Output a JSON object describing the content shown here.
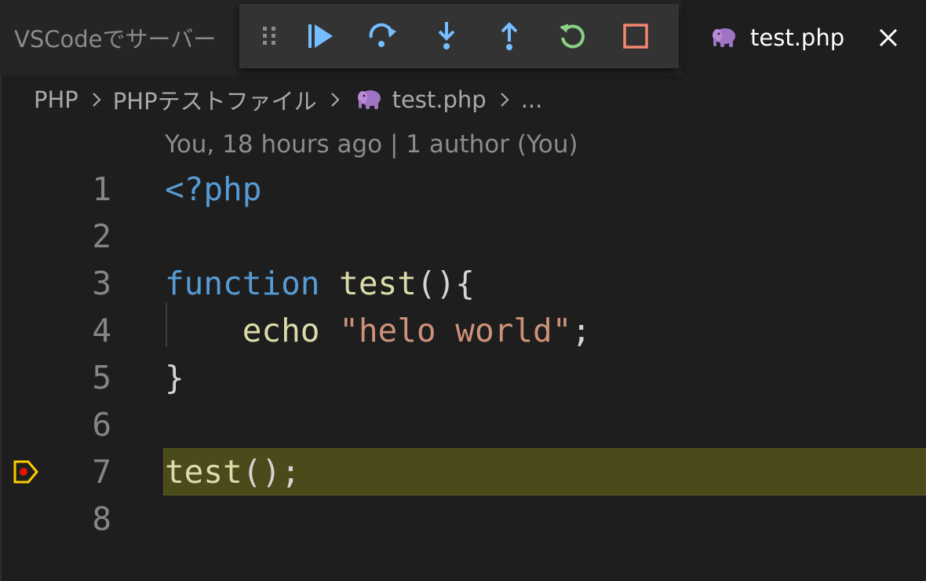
{
  "tabs": {
    "inactive_label": "VSCodeでサーバー",
    "active_label": "test.php"
  },
  "debug_toolbar": {
    "buttons": [
      "drag-handle",
      "continue",
      "step-over",
      "step-into",
      "step-out",
      "restart",
      "stop"
    ],
    "colors": {
      "blue": "#75beff",
      "green": "#89d185",
      "red": "#f48771"
    }
  },
  "breadcrumb": {
    "items": [
      "PHP",
      "PHPテストファイル",
      "test.php",
      "..."
    ]
  },
  "blame": {
    "text": "You, 18 hours ago | 1 author (You)"
  },
  "editor": {
    "current_line": 7,
    "lines": [
      {
        "number": "1",
        "tokens": [
          "<?php"
        ]
      },
      {
        "number": "2",
        "tokens": []
      },
      {
        "number": "3",
        "tokens": [
          "function",
          "test",
          "(){"
        ]
      },
      {
        "number": "4",
        "tokens": [
          "echo",
          "\"helo world\"",
          ";"
        ]
      },
      {
        "number": "5",
        "tokens": [
          "}"
        ]
      },
      {
        "number": "6",
        "tokens": []
      },
      {
        "number": "7",
        "tokens": [
          "test",
          "();"
        ]
      },
      {
        "number": "8",
        "tokens": []
      }
    ]
  },
  "colors": {
    "background": "#1e1e1e",
    "keyword": "#569cd6",
    "function": "#dcdcaa",
    "string": "#ce9178",
    "current_line_highlight": "#4b4a1a",
    "breakpoint_marker": "#ffcc00",
    "php_icon": "#a074c4"
  }
}
